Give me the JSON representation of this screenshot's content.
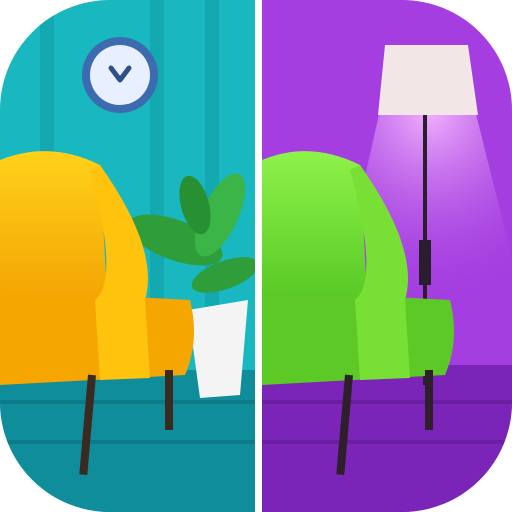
{
  "app_icon": {
    "subject": "spot-the-difference-armchairs",
    "colors": {
      "left_wall": "#19b7bf",
      "left_stripe": "#13a7b0",
      "left_floor": "#0f8d9a",
      "right_wall": "#a43ee0",
      "right_floor": "#7a25b8",
      "divider": "#ffffff",
      "yellow_chair": "#f7b800",
      "green_chair": "#6bd92e",
      "clock_face": "#e8f0ff",
      "clock_rim": "#3d6bb0",
      "lamp_shade": "#f2e6e6",
      "lamp_glow": "#f3a6ff"
    },
    "icons": [
      "clock-icon",
      "armchair-icon",
      "plant-icon",
      "floor-lamp-icon"
    ]
  }
}
